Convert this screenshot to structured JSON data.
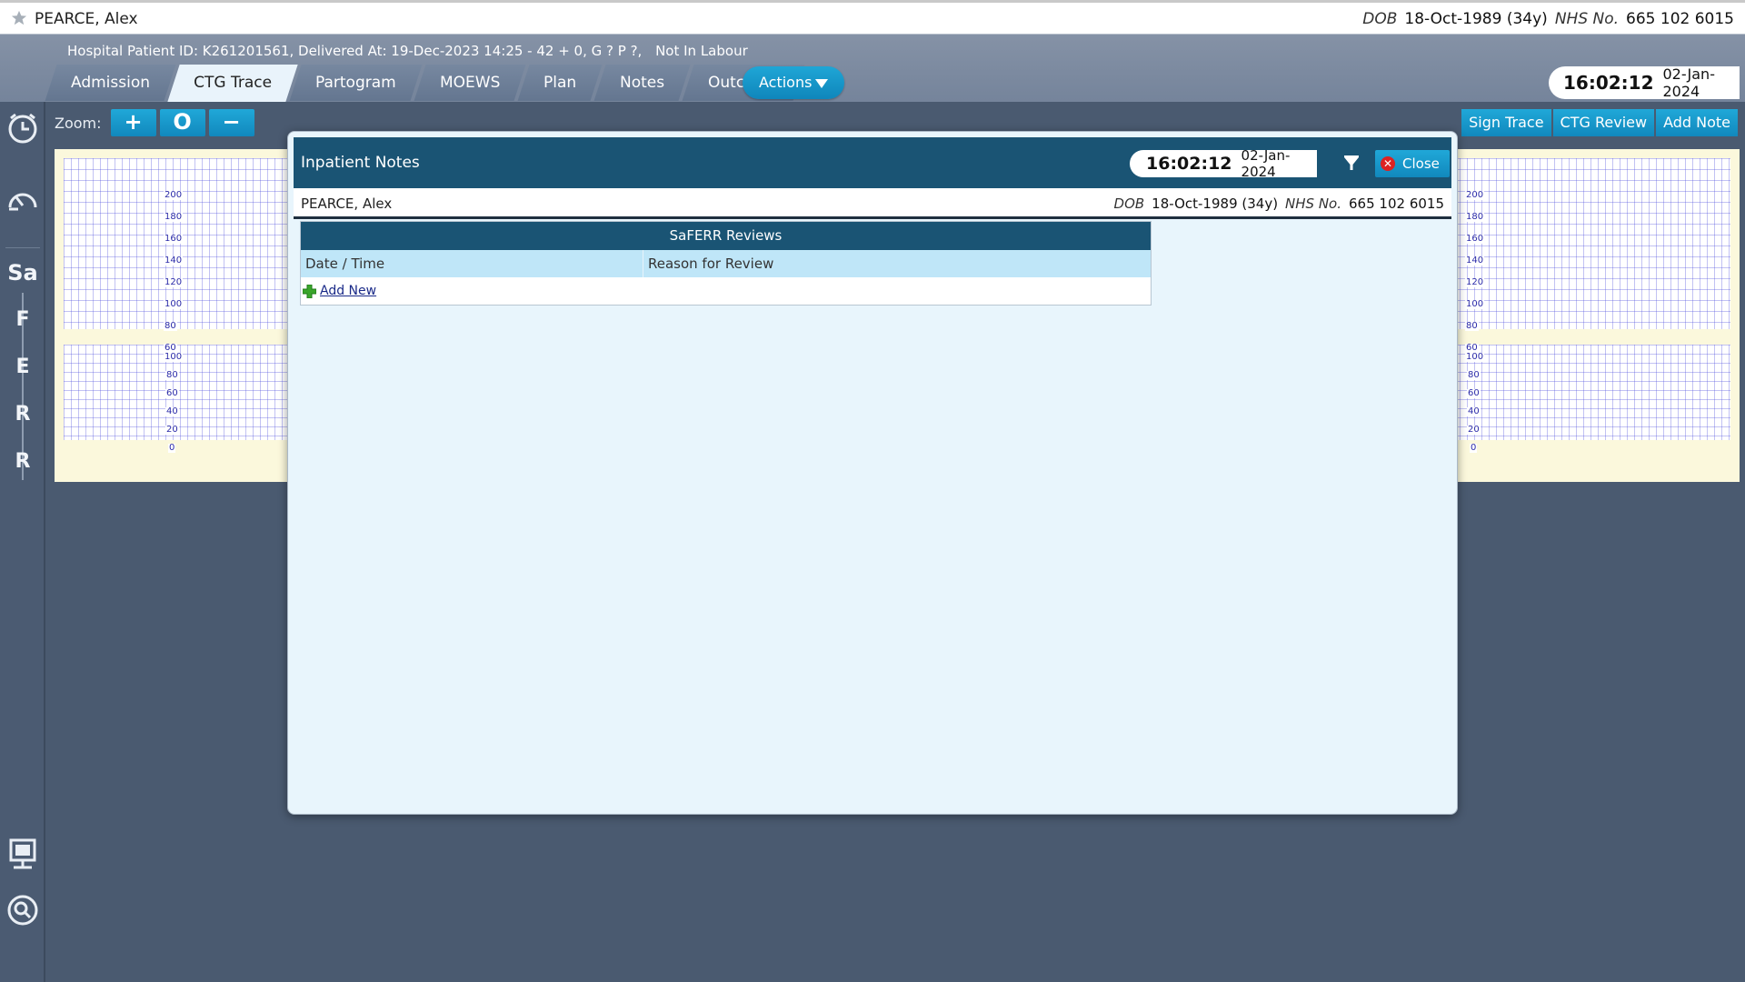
{
  "patient": {
    "name": "PEARCE, Alex",
    "dob_label": "DOB",
    "dob": "18-Oct-1989 (34y)",
    "nhs_label": "NHS No.",
    "nhs": "665 102 6015"
  },
  "info": {
    "details": "Hospital Patient ID: K261201561, Delivered At: 19-Dec-2023 14:25 - 42 + 0, G ? P ?,",
    "status": "Not In Labour"
  },
  "tabs": [
    {
      "label": "Admission"
    },
    {
      "label": "CTG Trace",
      "active": true
    },
    {
      "label": "Partogram"
    },
    {
      "label": "MOEWS"
    },
    {
      "label": "Plan"
    },
    {
      "label": "Notes"
    },
    {
      "label": "Outcome"
    }
  ],
  "actions_label": "Actions",
  "clock": {
    "time": "16:02:12",
    "date": "02-Jan-2024"
  },
  "sidebar": {
    "icons": [
      "clock-icon",
      "gauge-icon",
      "monitor-icon",
      "search-icon"
    ],
    "letters": [
      "Sa",
      "F",
      "E",
      "R",
      "R"
    ]
  },
  "zoom": {
    "label": "Zoom:",
    "in": "+",
    "reset": "O",
    "out": "−"
  },
  "toolbar": {
    "sign_trace": "Sign Trace",
    "ctg_review": "CTG Review",
    "add_note": "Add Note"
  },
  "trace": {
    "fhr_ticks": [
      "200",
      "180",
      "160",
      "140",
      "120",
      "100",
      "80",
      "60"
    ],
    "toco_ticks": [
      "100",
      "80",
      "60",
      "40",
      "20",
      "0"
    ]
  },
  "modal": {
    "title": "Inpatient Notes",
    "clock": {
      "time": "16:02:12",
      "date": "02-Jan-2024"
    },
    "close_label": "Close",
    "table": {
      "title": "SaFERR Reviews",
      "columns": [
        "Date / Time",
        "Reason for Review"
      ],
      "add_new": "Add New"
    }
  },
  "colors": {
    "header_blue": "#1a5474",
    "button_blue": "#1598c9",
    "modal_bg": "#e8f5fc"
  }
}
